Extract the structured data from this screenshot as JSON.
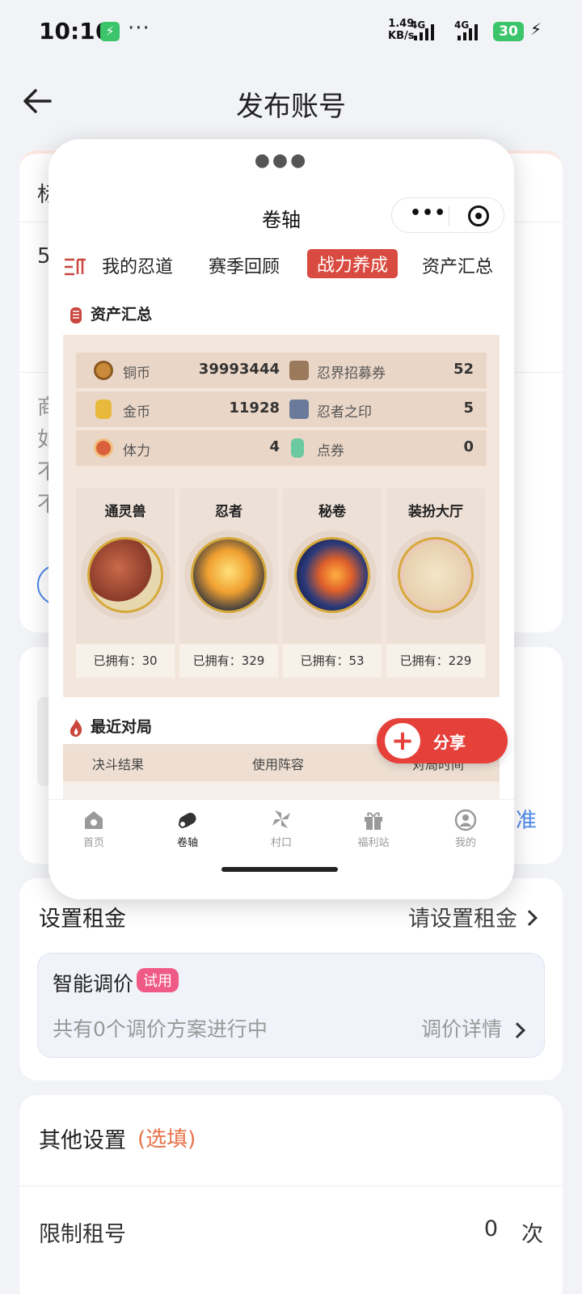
{
  "status_bar": {
    "time": "10:16",
    "app_badge": "⚡",
    "more": "···",
    "speed_value": "1.49",
    "speed_unit": "KB/s",
    "signal1": "4G",
    "signal2": "4G",
    "battery": "30"
  },
  "header": {
    "title": "发布账号"
  },
  "background": {
    "card1_line1": "标",
    "card1_line2": "5",
    "card1_gray": [
      "商",
      "如",
      "不",
      "不"
    ],
    "card2_link": "准"
  },
  "rent": {
    "label": "设置租金",
    "value": "请设置租金",
    "smart_title": "智能调价",
    "trial_badge": "试用",
    "smart_desc": "共有0个调价方案进行中",
    "smart_detail": "调价详情"
  },
  "other": {
    "label": "其他设置",
    "optional": "(选填)",
    "limit_label": "限制租号",
    "limit_value": "0",
    "limit_unit": "次"
  },
  "mini_program": {
    "title": "卷轴",
    "capsule_more": "•••",
    "tabs": [
      "我的忍道",
      "赛季回顾",
      "战力养成",
      "资产汇总"
    ],
    "active_tab": "战力养成",
    "assets_section": "资产汇总",
    "assets": [
      {
        "left_label": "铜币",
        "left_value": "39993444",
        "right_label": "忍界招募券",
        "right_value": "52"
      },
      {
        "left_label": "金币",
        "left_value": "11928",
        "right_label": "忍者之印",
        "right_value": "5"
      },
      {
        "left_label": "体力",
        "left_value": "4",
        "right_label": "点券",
        "right_value": "0"
      }
    ],
    "collections": [
      {
        "title": "通灵兽",
        "owned": "已拥有：30"
      },
      {
        "title": "忍者",
        "owned": "已拥有：329"
      },
      {
        "title": "秘卷",
        "owned": "已拥有：53"
      },
      {
        "title": "装扮大厅",
        "owned": "已拥有：229"
      }
    ],
    "recent_section": "最近对局",
    "battle_headers": [
      "决斗结果",
      "使用阵容",
      "对局时间"
    ],
    "share_label": "分享",
    "nav": [
      {
        "label": "首页",
        "icon": "home-icon"
      },
      {
        "label": "卷轴",
        "icon": "scroll-icon"
      },
      {
        "label": "村口",
        "icon": "pinwheel-icon"
      },
      {
        "label": "福利站",
        "icon": "gift-icon"
      },
      {
        "label": "我的",
        "icon": "profile-icon"
      }
    ],
    "active_nav": "卷轴"
  },
  "colors": {
    "accent_red": "#d94a40",
    "share_red": "#e5403a",
    "link_blue": "#4b87e8",
    "trial_pink": "#ef5a86",
    "optional_orange": "#e8734a"
  }
}
